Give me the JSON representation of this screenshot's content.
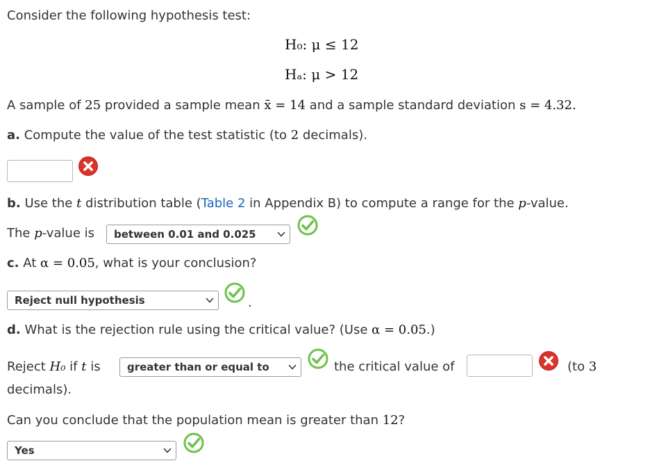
{
  "intro": "Consider the following hypothesis test:",
  "hypotheses": {
    "h0": "H₀: μ ≤ 12",
    "ha": "Hₐ: μ > 12"
  },
  "sample_sentence": {
    "p1": "A sample of ",
    "n": "25",
    "p2": " provided a sample mean ",
    "xbar_eq": "x̄ = 14",
    "p3": " and a sample standard deviation ",
    "s_eq": "s = 4.32."
  },
  "part_a": {
    "label": "a.",
    "text1": " Compute the value of the test statistic (to ",
    "decimals": "2",
    "text2": " decimals).",
    "input_value": "",
    "status_icon": "x-icon"
  },
  "part_b": {
    "label": "b.",
    "text1": " Use the ",
    "t": "t",
    "text2": " distribution table (",
    "link": "Table 2",
    "text3": " in Appendix B) to compute a range for the ",
    "p": "p",
    "text4": "-value.",
    "answer_pre": "The ",
    "answer_p": "p",
    "answer_post": "-value is",
    "dropdown_value": "between 0.01 and 0.025",
    "status_icon": "check-icon"
  },
  "part_c": {
    "label": "c.",
    "text1": " At ",
    "alpha_eq": "α = 0.05",
    "text2": ", what is your conclusion?",
    "dropdown_value": "Reject null hypothesis",
    "period": ".",
    "status_icon": "check-icon"
  },
  "part_d": {
    "label": "d.",
    "text1": " What is the rejection rule using the critical value? (Use ",
    "alpha_eq": "α = 0.05",
    "text2": ".)",
    "reject_pre": "Reject ",
    "h0": "H₀",
    "if_t": " if ",
    "t": "t",
    "is": " is",
    "dropdown_value": "greater than or equal to",
    "crit_text": "the critical value of",
    "input_value": "",
    "to3_pre": "(to ",
    "to3_n": "3",
    "decimals_word": "decimals).",
    "status_icon_dropdown": "check-icon",
    "status_icon_input": "x-icon"
  },
  "conclusion": {
    "question1": "Can you conclude that the population mean is greater than ",
    "value": "12",
    "question2": "?",
    "dropdown_value": "Yes",
    "status_icon": "check-icon"
  },
  "colors": {
    "check": "#6cc24a",
    "x": "#d9342b",
    "link": "#1a66b8"
  }
}
